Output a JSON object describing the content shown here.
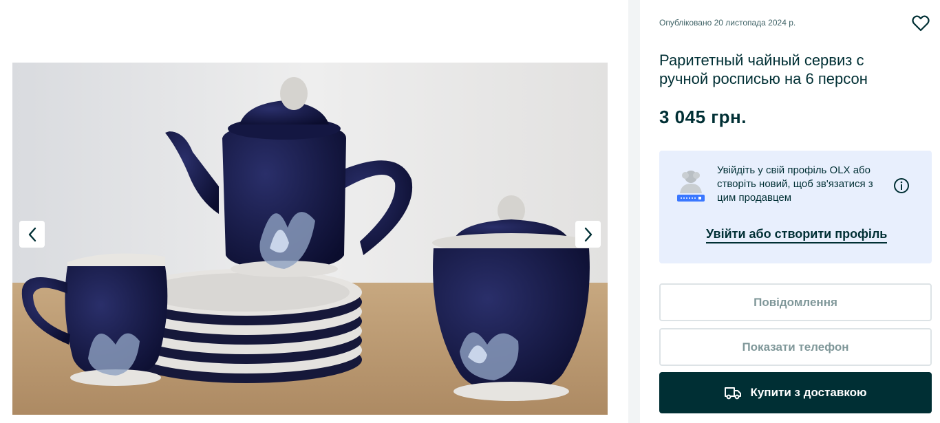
{
  "gallery": {
    "image_alt": "Раритетный чайный сервиз с ручной росписью на 6 персон",
    "prev_icon": "chevron-left-icon",
    "next_icon": "chevron-right-icon"
  },
  "ad": {
    "published": "Опубліковано 20 листопада 2024 р.",
    "favorite_icon": "heart-icon",
    "title": "Раритетный чайный сервиз с ручной росписью на 6 персон",
    "price": "3 045 грн."
  },
  "login_prompt": {
    "text": "Увійдіть у свій профіль OLX або створіть новий, щоб зв'язатися з цим продавцем",
    "link": "Увійти або створити профіль",
    "info_icon": "info-icon"
  },
  "actions": {
    "message": "Повідомлення",
    "phone": "Показати телефон",
    "buy": "Купити з доставкою",
    "buy_icon": "truck-icon"
  },
  "colors": {
    "brand_dark": "#002f34",
    "login_bg": "#e8effd",
    "muted_text": "#7f9799"
  }
}
